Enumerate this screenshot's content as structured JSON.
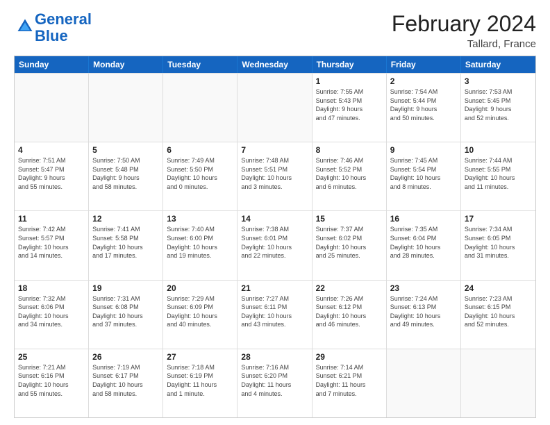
{
  "header": {
    "logo_general": "General",
    "logo_blue": "Blue",
    "main_title": "February 2024",
    "subtitle": "Tallard, France"
  },
  "days_of_week": [
    "Sunday",
    "Monday",
    "Tuesday",
    "Wednesday",
    "Thursday",
    "Friday",
    "Saturday"
  ],
  "weeks": [
    [
      {
        "day": "",
        "info": ""
      },
      {
        "day": "",
        "info": ""
      },
      {
        "day": "",
        "info": ""
      },
      {
        "day": "",
        "info": ""
      },
      {
        "day": "1",
        "info": "Sunrise: 7:55 AM\nSunset: 5:43 PM\nDaylight: 9 hours\nand 47 minutes."
      },
      {
        "day": "2",
        "info": "Sunrise: 7:54 AM\nSunset: 5:44 PM\nDaylight: 9 hours\nand 50 minutes."
      },
      {
        "day": "3",
        "info": "Sunrise: 7:53 AM\nSunset: 5:45 PM\nDaylight: 9 hours\nand 52 minutes."
      }
    ],
    [
      {
        "day": "4",
        "info": "Sunrise: 7:51 AM\nSunset: 5:47 PM\nDaylight: 9 hours\nand 55 minutes."
      },
      {
        "day": "5",
        "info": "Sunrise: 7:50 AM\nSunset: 5:48 PM\nDaylight: 9 hours\nand 58 minutes."
      },
      {
        "day": "6",
        "info": "Sunrise: 7:49 AM\nSunset: 5:50 PM\nDaylight: 10 hours\nand 0 minutes."
      },
      {
        "day": "7",
        "info": "Sunrise: 7:48 AM\nSunset: 5:51 PM\nDaylight: 10 hours\nand 3 minutes."
      },
      {
        "day": "8",
        "info": "Sunrise: 7:46 AM\nSunset: 5:52 PM\nDaylight: 10 hours\nand 6 minutes."
      },
      {
        "day": "9",
        "info": "Sunrise: 7:45 AM\nSunset: 5:54 PM\nDaylight: 10 hours\nand 8 minutes."
      },
      {
        "day": "10",
        "info": "Sunrise: 7:44 AM\nSunset: 5:55 PM\nDaylight: 10 hours\nand 11 minutes."
      }
    ],
    [
      {
        "day": "11",
        "info": "Sunrise: 7:42 AM\nSunset: 5:57 PM\nDaylight: 10 hours\nand 14 minutes."
      },
      {
        "day": "12",
        "info": "Sunrise: 7:41 AM\nSunset: 5:58 PM\nDaylight: 10 hours\nand 17 minutes."
      },
      {
        "day": "13",
        "info": "Sunrise: 7:40 AM\nSunset: 6:00 PM\nDaylight: 10 hours\nand 19 minutes."
      },
      {
        "day": "14",
        "info": "Sunrise: 7:38 AM\nSunset: 6:01 PM\nDaylight: 10 hours\nand 22 minutes."
      },
      {
        "day": "15",
        "info": "Sunrise: 7:37 AM\nSunset: 6:02 PM\nDaylight: 10 hours\nand 25 minutes."
      },
      {
        "day": "16",
        "info": "Sunrise: 7:35 AM\nSunset: 6:04 PM\nDaylight: 10 hours\nand 28 minutes."
      },
      {
        "day": "17",
        "info": "Sunrise: 7:34 AM\nSunset: 6:05 PM\nDaylight: 10 hours\nand 31 minutes."
      }
    ],
    [
      {
        "day": "18",
        "info": "Sunrise: 7:32 AM\nSunset: 6:06 PM\nDaylight: 10 hours\nand 34 minutes."
      },
      {
        "day": "19",
        "info": "Sunrise: 7:31 AM\nSunset: 6:08 PM\nDaylight: 10 hours\nand 37 minutes."
      },
      {
        "day": "20",
        "info": "Sunrise: 7:29 AM\nSunset: 6:09 PM\nDaylight: 10 hours\nand 40 minutes."
      },
      {
        "day": "21",
        "info": "Sunrise: 7:27 AM\nSunset: 6:11 PM\nDaylight: 10 hours\nand 43 minutes."
      },
      {
        "day": "22",
        "info": "Sunrise: 7:26 AM\nSunset: 6:12 PM\nDaylight: 10 hours\nand 46 minutes."
      },
      {
        "day": "23",
        "info": "Sunrise: 7:24 AM\nSunset: 6:13 PM\nDaylight: 10 hours\nand 49 minutes."
      },
      {
        "day": "24",
        "info": "Sunrise: 7:23 AM\nSunset: 6:15 PM\nDaylight: 10 hours\nand 52 minutes."
      }
    ],
    [
      {
        "day": "25",
        "info": "Sunrise: 7:21 AM\nSunset: 6:16 PM\nDaylight: 10 hours\nand 55 minutes."
      },
      {
        "day": "26",
        "info": "Sunrise: 7:19 AM\nSunset: 6:17 PM\nDaylight: 10 hours\nand 58 minutes."
      },
      {
        "day": "27",
        "info": "Sunrise: 7:18 AM\nSunset: 6:19 PM\nDaylight: 11 hours\nand 1 minute."
      },
      {
        "day": "28",
        "info": "Sunrise: 7:16 AM\nSunset: 6:20 PM\nDaylight: 11 hours\nand 4 minutes."
      },
      {
        "day": "29",
        "info": "Sunrise: 7:14 AM\nSunset: 6:21 PM\nDaylight: 11 hours\nand 7 minutes."
      },
      {
        "day": "",
        "info": ""
      },
      {
        "day": "",
        "info": ""
      }
    ]
  ]
}
